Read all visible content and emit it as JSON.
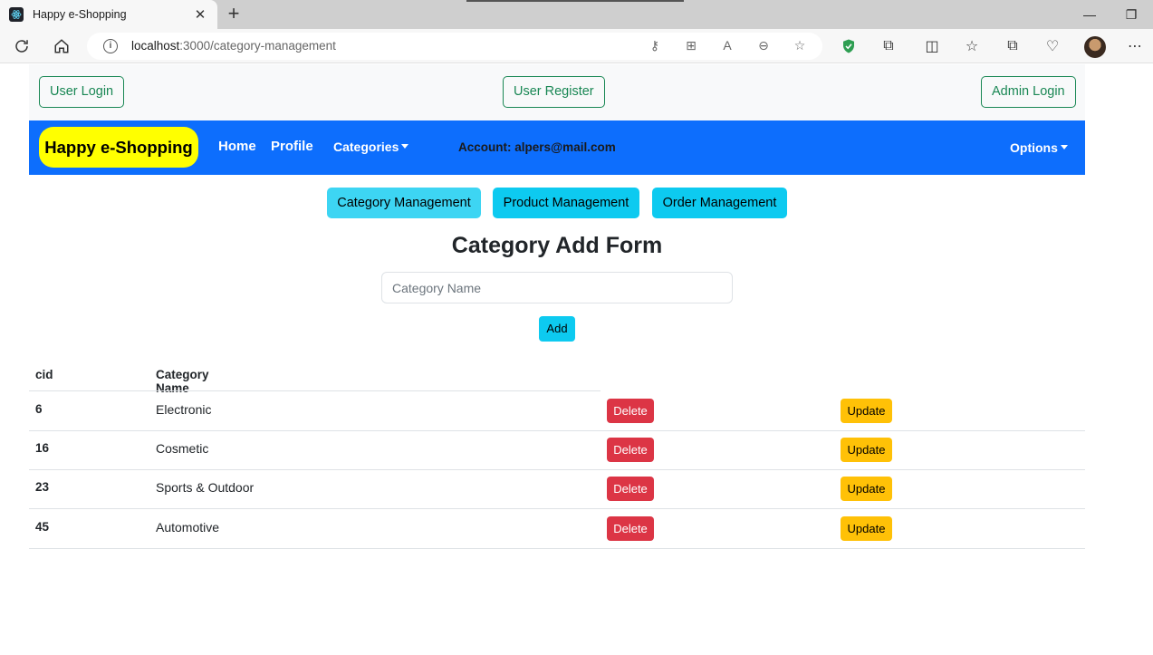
{
  "browser": {
    "tab_title": "Happy e-Shopping",
    "url_host": "localhost",
    "url_rest": ":3000/category-management"
  },
  "auth": {
    "user_login": "User Login",
    "user_register": "User Register",
    "admin_login": "Admin Login"
  },
  "navbar": {
    "brand": "Happy e-Shopping",
    "home": "Home",
    "profile": "Profile",
    "categories": "Categories",
    "account": "Account: alpers@mail.com",
    "options": "Options"
  },
  "management": {
    "category": "Category Management",
    "product": "Product Management",
    "order": "Order Management"
  },
  "form": {
    "title": "Category Add Form",
    "input_placeholder": "Category Name",
    "add_label": "Add"
  },
  "table": {
    "headers": [
      "cid",
      "Category Name"
    ],
    "delete_label": "Delete",
    "update_label": "Update",
    "rows": [
      {
        "cid": "6",
        "name": "Electronic"
      },
      {
        "cid": "16",
        "name": "Cosmetic"
      },
      {
        "cid": "23",
        "name": "Sports & Outdoor"
      },
      {
        "cid": "45",
        "name": "Automotive"
      }
    ]
  },
  "colors": {
    "navbar": "#0d6efd",
    "brand_bg": "#ffff00",
    "info": "#0dcaf0",
    "danger": "#dc3545",
    "warning": "#ffc107",
    "success": "#198754"
  }
}
